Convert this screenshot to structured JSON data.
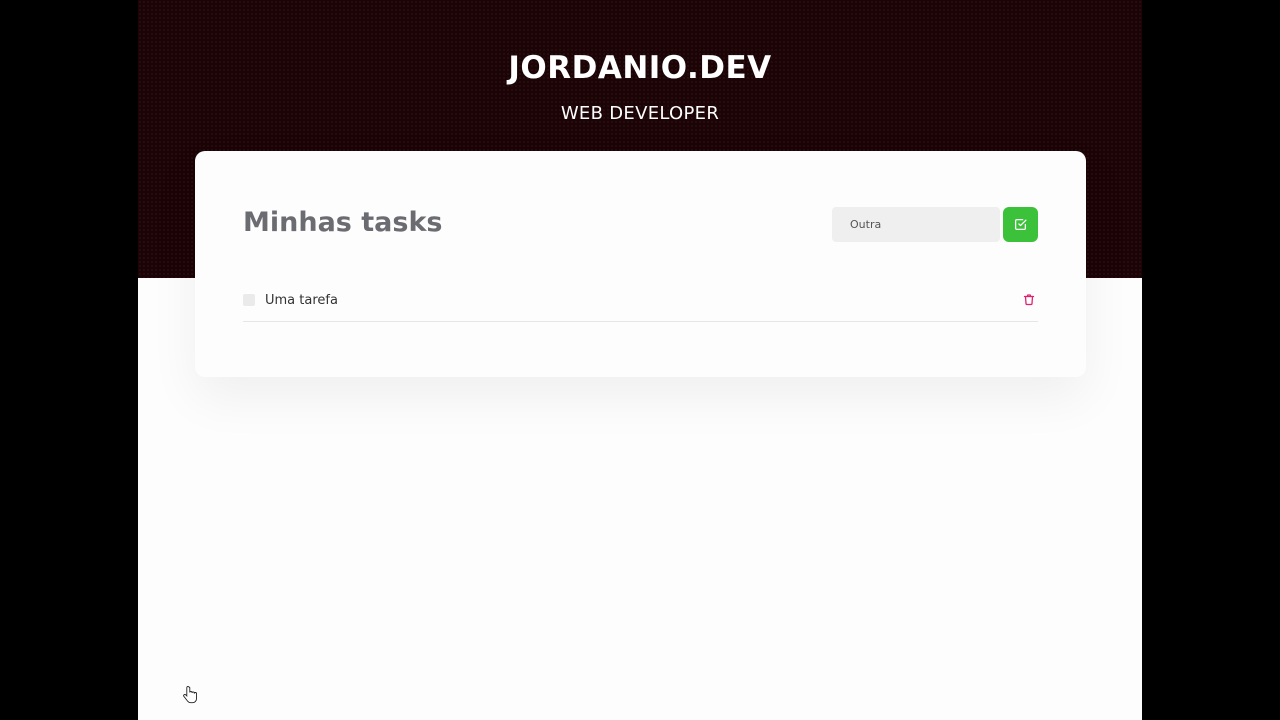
{
  "header": {
    "brand": "JORDANIO.DEV",
    "subtitle": "WEB DEVELOPER"
  },
  "card": {
    "title": "Minhas tasks",
    "input_value": "Outra",
    "add_icon": "check-square-icon"
  },
  "tasks": [
    {
      "text": "Uma tarefa",
      "done": false
    }
  ],
  "icons": {
    "delete": "trash-icon",
    "cursor": "hand-pointer-icon"
  },
  "colors": {
    "hero_bg": "#1b0306",
    "add_button": "#3cc23a",
    "delete_icon": "#e0216f",
    "title_text": "#6b6b72"
  }
}
